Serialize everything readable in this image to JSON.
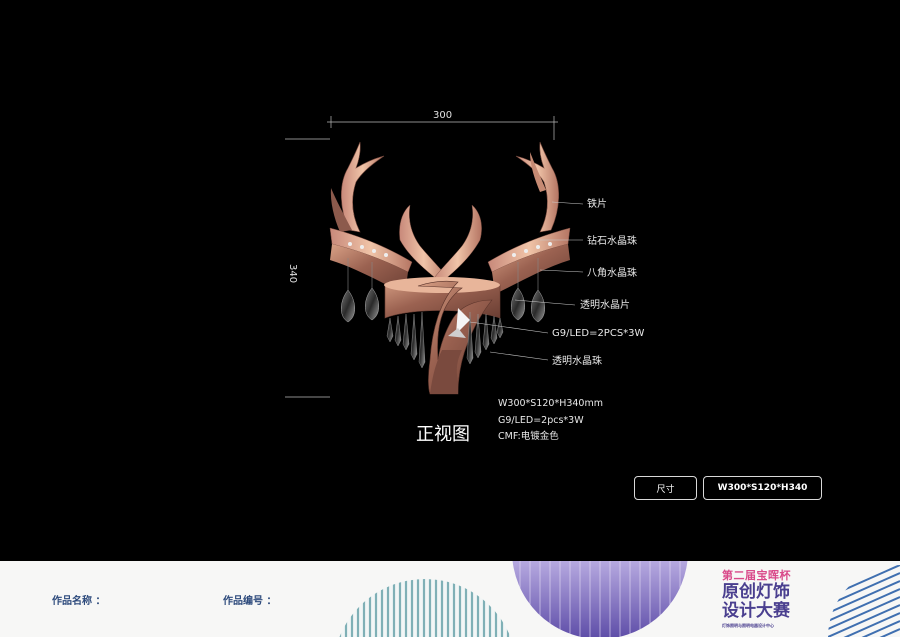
{
  "drawing": {
    "width_dimension": "300",
    "height_dimension": "340",
    "callouts": [
      "铁片",
      "钻石水晶珠",
      "八角水晶珠",
      "透明水晶片",
      "G9/LED=2PCS*3W",
      "透明水晶珠"
    ],
    "view_title": "正视图",
    "specs": [
      "W300*S120*H340mm",
      "G9/LED=2pcs*3W",
      "CMF:电镀金色"
    ]
  },
  "size_table": {
    "label": "尺寸",
    "value": "W300*S120*H340"
  },
  "footer": {
    "name_label": "作品名称 ：",
    "number_label": "作品编号 ：",
    "brand_top": "第二届宝晖杯",
    "brand_line1": "原创灯饰",
    "brand_line2": "设计大赛",
    "brand_sub": "灯饰照明与照明电器设计中心",
    "colors": {
      "brand_purple": "#4a3f8f",
      "brand_pink": "#d94a8a",
      "field_blue": "#2d4a7c"
    }
  }
}
